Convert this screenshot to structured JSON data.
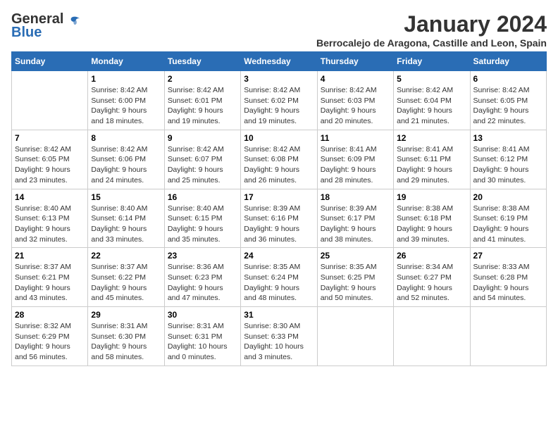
{
  "logo": {
    "general": "General",
    "blue": "Blue"
  },
  "title": "January 2024",
  "subtitle": "Berrocalejo de Aragona, Castille and Leon, Spain",
  "columns": [
    "Sunday",
    "Monday",
    "Tuesday",
    "Wednesday",
    "Thursday",
    "Friday",
    "Saturday"
  ],
  "weeks": [
    [
      {
        "day": "",
        "lines": []
      },
      {
        "day": "1",
        "lines": [
          "Sunrise: 8:42 AM",
          "Sunset: 6:00 PM",
          "Daylight: 9 hours",
          "and 18 minutes."
        ]
      },
      {
        "day": "2",
        "lines": [
          "Sunrise: 8:42 AM",
          "Sunset: 6:01 PM",
          "Daylight: 9 hours",
          "and 19 minutes."
        ]
      },
      {
        "day": "3",
        "lines": [
          "Sunrise: 8:42 AM",
          "Sunset: 6:02 PM",
          "Daylight: 9 hours",
          "and 19 minutes."
        ]
      },
      {
        "day": "4",
        "lines": [
          "Sunrise: 8:42 AM",
          "Sunset: 6:03 PM",
          "Daylight: 9 hours",
          "and 20 minutes."
        ]
      },
      {
        "day": "5",
        "lines": [
          "Sunrise: 8:42 AM",
          "Sunset: 6:04 PM",
          "Daylight: 9 hours",
          "and 21 minutes."
        ]
      },
      {
        "day": "6",
        "lines": [
          "Sunrise: 8:42 AM",
          "Sunset: 6:05 PM",
          "Daylight: 9 hours",
          "and 22 minutes."
        ]
      }
    ],
    [
      {
        "day": "7",
        "lines": [
          "Sunrise: 8:42 AM",
          "Sunset: 6:05 PM",
          "Daylight: 9 hours",
          "and 23 minutes."
        ]
      },
      {
        "day": "8",
        "lines": [
          "Sunrise: 8:42 AM",
          "Sunset: 6:06 PM",
          "Daylight: 9 hours",
          "and 24 minutes."
        ]
      },
      {
        "day": "9",
        "lines": [
          "Sunrise: 8:42 AM",
          "Sunset: 6:07 PM",
          "Daylight: 9 hours",
          "and 25 minutes."
        ]
      },
      {
        "day": "10",
        "lines": [
          "Sunrise: 8:42 AM",
          "Sunset: 6:08 PM",
          "Daylight: 9 hours",
          "and 26 minutes."
        ]
      },
      {
        "day": "11",
        "lines": [
          "Sunrise: 8:41 AM",
          "Sunset: 6:09 PM",
          "Daylight: 9 hours",
          "and 28 minutes."
        ]
      },
      {
        "day": "12",
        "lines": [
          "Sunrise: 8:41 AM",
          "Sunset: 6:11 PM",
          "Daylight: 9 hours",
          "and 29 minutes."
        ]
      },
      {
        "day": "13",
        "lines": [
          "Sunrise: 8:41 AM",
          "Sunset: 6:12 PM",
          "Daylight: 9 hours",
          "and 30 minutes."
        ]
      }
    ],
    [
      {
        "day": "14",
        "lines": [
          "Sunrise: 8:40 AM",
          "Sunset: 6:13 PM",
          "Daylight: 9 hours",
          "and 32 minutes."
        ]
      },
      {
        "day": "15",
        "lines": [
          "Sunrise: 8:40 AM",
          "Sunset: 6:14 PM",
          "Daylight: 9 hours",
          "and 33 minutes."
        ]
      },
      {
        "day": "16",
        "lines": [
          "Sunrise: 8:40 AM",
          "Sunset: 6:15 PM",
          "Daylight: 9 hours",
          "and 35 minutes."
        ]
      },
      {
        "day": "17",
        "lines": [
          "Sunrise: 8:39 AM",
          "Sunset: 6:16 PM",
          "Daylight: 9 hours",
          "and 36 minutes."
        ]
      },
      {
        "day": "18",
        "lines": [
          "Sunrise: 8:39 AM",
          "Sunset: 6:17 PM",
          "Daylight: 9 hours",
          "and 38 minutes."
        ]
      },
      {
        "day": "19",
        "lines": [
          "Sunrise: 8:38 AM",
          "Sunset: 6:18 PM",
          "Daylight: 9 hours",
          "and 39 minutes."
        ]
      },
      {
        "day": "20",
        "lines": [
          "Sunrise: 8:38 AM",
          "Sunset: 6:19 PM",
          "Daylight: 9 hours",
          "and 41 minutes."
        ]
      }
    ],
    [
      {
        "day": "21",
        "lines": [
          "Sunrise: 8:37 AM",
          "Sunset: 6:21 PM",
          "Daylight: 9 hours",
          "and 43 minutes."
        ]
      },
      {
        "day": "22",
        "lines": [
          "Sunrise: 8:37 AM",
          "Sunset: 6:22 PM",
          "Daylight: 9 hours",
          "and 45 minutes."
        ]
      },
      {
        "day": "23",
        "lines": [
          "Sunrise: 8:36 AM",
          "Sunset: 6:23 PM",
          "Daylight: 9 hours",
          "and 47 minutes."
        ]
      },
      {
        "day": "24",
        "lines": [
          "Sunrise: 8:35 AM",
          "Sunset: 6:24 PM",
          "Daylight: 9 hours",
          "and 48 minutes."
        ]
      },
      {
        "day": "25",
        "lines": [
          "Sunrise: 8:35 AM",
          "Sunset: 6:25 PM",
          "Daylight: 9 hours",
          "and 50 minutes."
        ]
      },
      {
        "day": "26",
        "lines": [
          "Sunrise: 8:34 AM",
          "Sunset: 6:27 PM",
          "Daylight: 9 hours",
          "and 52 minutes."
        ]
      },
      {
        "day": "27",
        "lines": [
          "Sunrise: 8:33 AM",
          "Sunset: 6:28 PM",
          "Daylight: 9 hours",
          "and 54 minutes."
        ]
      }
    ],
    [
      {
        "day": "28",
        "lines": [
          "Sunrise: 8:32 AM",
          "Sunset: 6:29 PM",
          "Daylight: 9 hours",
          "and 56 minutes."
        ]
      },
      {
        "day": "29",
        "lines": [
          "Sunrise: 8:31 AM",
          "Sunset: 6:30 PM",
          "Daylight: 9 hours",
          "and 58 minutes."
        ]
      },
      {
        "day": "30",
        "lines": [
          "Sunrise: 8:31 AM",
          "Sunset: 6:31 PM",
          "Daylight: 10 hours",
          "and 0 minutes."
        ]
      },
      {
        "day": "31",
        "lines": [
          "Sunrise: 8:30 AM",
          "Sunset: 6:33 PM",
          "Daylight: 10 hours",
          "and 3 minutes."
        ]
      },
      {
        "day": "",
        "lines": []
      },
      {
        "day": "",
        "lines": []
      },
      {
        "day": "",
        "lines": []
      }
    ]
  ]
}
